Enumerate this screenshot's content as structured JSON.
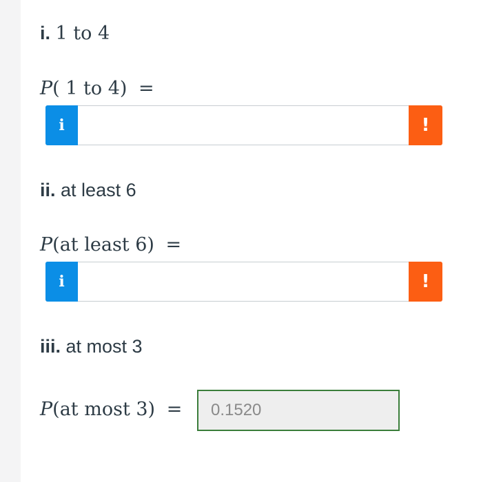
{
  "parts": [
    {
      "marker": "i.",
      "label": "1 to 4",
      "equation": "P( 1 to 4) =",
      "eq_var": "P",
      "eq_arg": "( 1 to 4)",
      "eq_sign": "="
    },
    {
      "marker": "ii.",
      "label": "at least 6",
      "eq_var": "P",
      "eq_arg": "(at least 6)",
      "eq_sign": "="
    },
    {
      "marker": "iii.",
      "label": "at most 3",
      "eq_var": "P",
      "eq_arg": "(at most 3)",
      "eq_sign": "=",
      "answer_value": "0.1520"
    }
  ],
  "buttons": {
    "info_glyph": "i",
    "warn_glyph": "!"
  },
  "colors": {
    "info": "#0b8ee6",
    "warning": "#fc5e13",
    "correct_border": "#3a7d3a"
  },
  "icons": [
    "info-icon",
    "warning-icon"
  ]
}
